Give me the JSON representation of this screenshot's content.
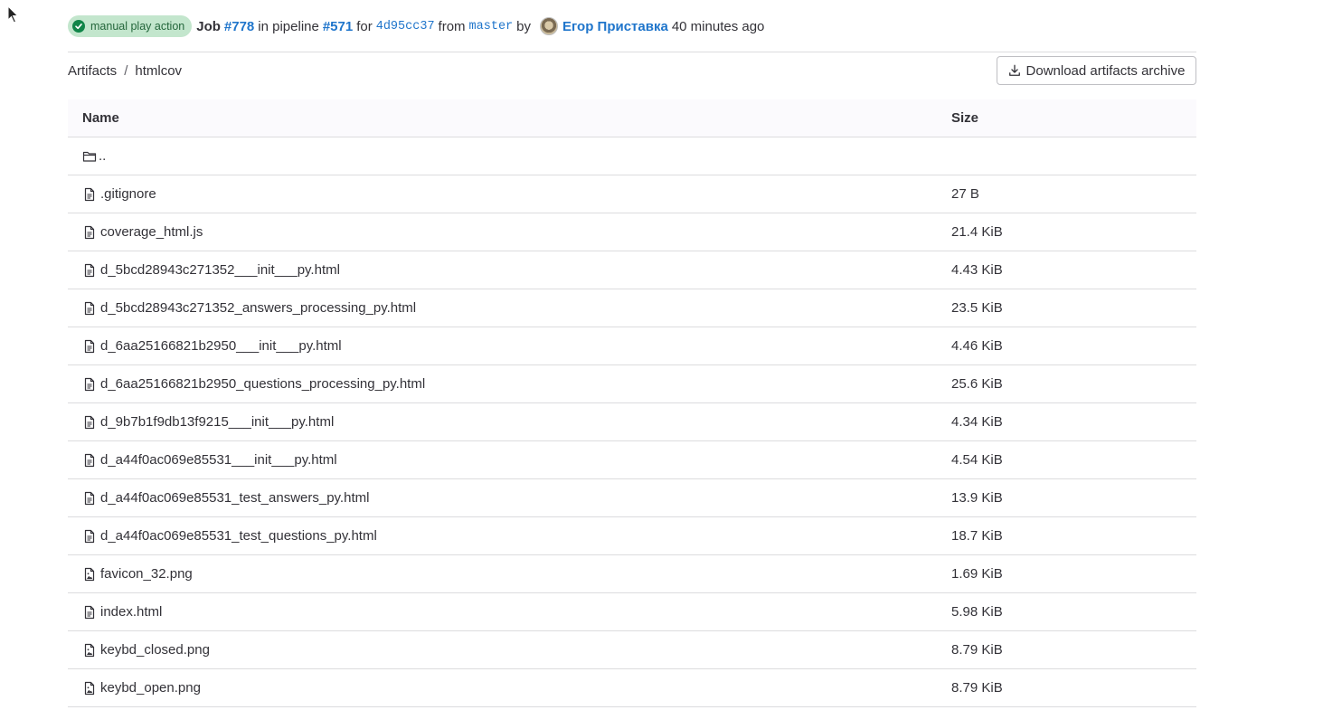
{
  "header": {
    "status_badge": "manual play action",
    "job_label": "Job",
    "job_id": "#778",
    "in_pipeline_text": "in pipeline",
    "pipeline_id": "#571",
    "for_text": "for",
    "commit_sha": "4d95cc37",
    "from_text": "from",
    "branch": "master",
    "by_text": "by",
    "author": "Егор Приставка",
    "time_ago": "40 minutes ago"
  },
  "breadcrumb": {
    "root": "Artifacts",
    "separator": "/",
    "current": "htmlcov"
  },
  "download_button": {
    "label": "Download artifacts archive",
    "icon": "download-icon"
  },
  "table": {
    "columns": {
      "name": "Name",
      "size": "Size"
    },
    "parent": {
      "name": "..",
      "icon": "folder-icon"
    },
    "rows": [
      {
        "name": ".gitignore",
        "size": "27 B",
        "icon": "file-icon"
      },
      {
        "name": "coverage_html.js",
        "size": "21.4 KiB",
        "icon": "file-icon"
      },
      {
        "name": "d_5bcd28943c271352___init___py.html",
        "size": "4.43 KiB",
        "icon": "file-icon"
      },
      {
        "name": "d_5bcd28943c271352_answers_processing_py.html",
        "size": "23.5 KiB",
        "icon": "file-icon"
      },
      {
        "name": "d_6aa25166821b2950___init___py.html",
        "size": "4.46 KiB",
        "icon": "file-icon"
      },
      {
        "name": "d_6aa25166821b2950_questions_processing_py.html",
        "size": "25.6 KiB",
        "icon": "file-icon"
      },
      {
        "name": "d_9b7b1f9db13f9215___init___py.html",
        "size": "4.34 KiB",
        "icon": "file-icon"
      },
      {
        "name": "d_a44f0ac069e85531___init___py.html",
        "size": "4.54 KiB",
        "icon": "file-icon"
      },
      {
        "name": "d_a44f0ac069e85531_test_answers_py.html",
        "size": "13.9 KiB",
        "icon": "file-icon"
      },
      {
        "name": "d_a44f0ac069e85531_test_questions_py.html",
        "size": "18.7 KiB",
        "icon": "file-icon"
      },
      {
        "name": "favicon_32.png",
        "size": "1.69 KiB",
        "icon": "image-file-icon"
      },
      {
        "name": "index.html",
        "size": "5.98 KiB",
        "icon": "file-icon"
      },
      {
        "name": "keybd_closed.png",
        "size": "8.79 KiB",
        "icon": "image-file-icon"
      },
      {
        "name": "keybd_open.png",
        "size": "8.79 KiB",
        "icon": "image-file-icon"
      }
    ]
  },
  "colors": {
    "link": "#1f75cb",
    "badge_bg": "#c3e6cd",
    "badge_icon": "#108548",
    "border": "#dcdcde"
  }
}
